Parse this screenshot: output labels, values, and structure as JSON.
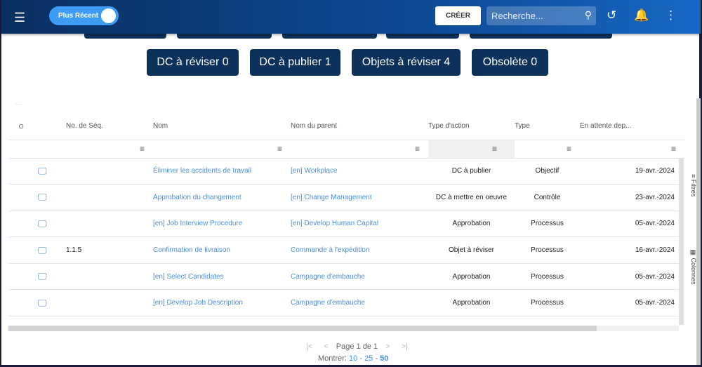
{
  "header": {
    "toggle_label": "Plus Récent",
    "create_label": "CRÉER",
    "search_placeholder": "Recherche..."
  },
  "pills": [
    "DC à réviser 0",
    "DC à publier 1",
    "Objets à réviser 4",
    "Obsolète 0"
  ],
  "table": {
    "columns": [
      "No. de Séq.",
      "Nom",
      "Nom du parent",
      "Type d'action",
      "Type",
      "En attente dep..."
    ],
    "rows": [
      {
        "seq": "",
        "nom": "Éliminer les accidents de travail",
        "parent": "[en] Workplace",
        "action": "DC à publier",
        "type": "Objectif",
        "date": "19-avr.-2024"
      },
      {
        "seq": "",
        "nom": "Approbation du changement",
        "parent": "[en] Change Management",
        "action": "DC à mettre en oeuvre",
        "type": "Contrôle",
        "date": "23-avr.-2024"
      },
      {
        "seq": "",
        "nom": "[en] Job Interview Procedure",
        "parent": "[en] Develop Human Capital",
        "action": "Approbation",
        "type": "Processus",
        "date": "05-avr.-2024"
      },
      {
        "seq": "1.1.5",
        "nom": "Confirmation de livraison",
        "parent": "Commande à l'expédition",
        "action": "Objet à réviser",
        "type": "Processus",
        "date": "16-avr.-2024"
      },
      {
        "seq": "",
        "nom": "[en] Select Candidates",
        "parent": "Campagne d'embauche",
        "action": "Approbation",
        "type": "Processus",
        "date": "05-avr.-2024"
      },
      {
        "seq": "",
        "nom": "[en] Develop Job Description",
        "parent": "Campagne d'embauche",
        "action": "Approbation",
        "type": "Processus",
        "date": "05-avr.-2024"
      }
    ]
  },
  "side": {
    "filters": "Filtres",
    "columns": "Colonnes"
  },
  "pagination": {
    "page_label": "Page",
    "page": "1",
    "of_label": "de",
    "total": "1",
    "show_label": "Montrer:",
    "sizes": [
      "10",
      "25",
      "50"
    ]
  }
}
